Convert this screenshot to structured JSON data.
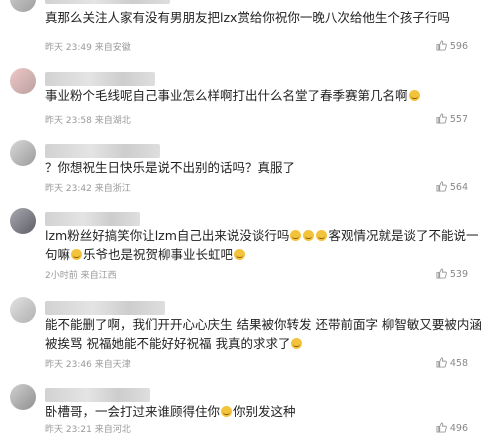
{
  "comments": [
    {
      "text": "真那么关注人家有没有男朋友把lzx赏给你祝你一晚八次给他生个孩子行吗",
      "time": "昨天 23:49",
      "location": "来自安徽",
      "likes": "596"
    },
    {
      "text": "事业粉个毛线呢自己事业怎么样啊打出什么名堂了春季赛第几名啊",
      "emoji_after": "laughing-crying",
      "time": "昨天 23:58",
      "location": "来自湖北",
      "likes": "557"
    },
    {
      "text": "？你想祝生日快乐是说不出别的话吗？真服了",
      "time": "昨天 23:42",
      "location": "来自浙江",
      "likes": "564"
    },
    {
      "text_part1": "lzm粉丝好搞笑你让lzm自己出来说没谈行吗",
      "text_part2": "客观情况就是谈了不能说一句嘛",
      "text_part3": "乐爷也是祝贺柳事业长虹吧",
      "time": "2小时前",
      "location": "来自江西",
      "likes": "539"
    },
    {
      "text": "能不能删了啊，我们开开心心庆生 结果被你转发 还带前面字 柳智敏又要被内涵被挨骂 祝福她能不能好好祝福 我真的求求了",
      "emoji_after": "laughing-crying",
      "time": "昨天 23:46",
      "location": "来自天津",
      "likes": "458"
    },
    {
      "text_part1": "卧槽哥，一会打过来谁顾得住你",
      "text_part2": "你别发这种",
      "time": "昨天 23:21",
      "location": "来自河北",
      "likes": "496"
    }
  ]
}
